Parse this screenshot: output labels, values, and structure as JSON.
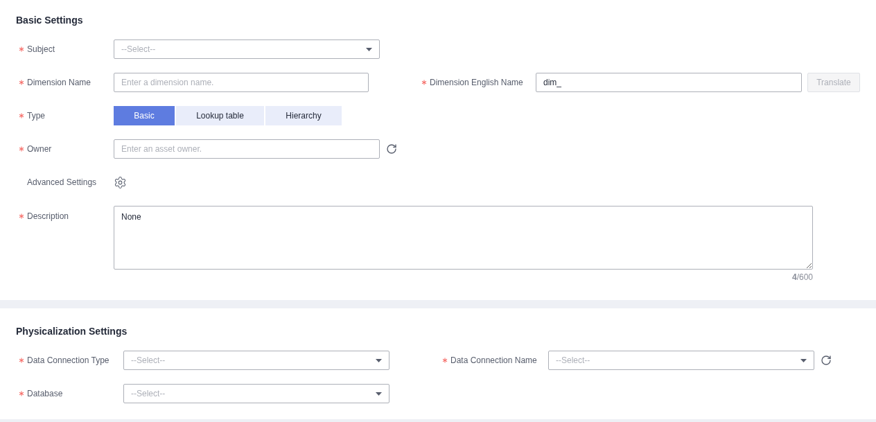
{
  "basic_settings": {
    "title": "Basic Settings",
    "fields": [
      {
        "kind": "select",
        "label": "Subject",
        "required": true,
        "placeholder": "--Select--"
      },
      {
        "kind": "input",
        "label": "Dimension Name",
        "required": true,
        "placeholder": "Enter a dimension name.",
        "side": {
          "kind": "input",
          "label": "Dimension English Name",
          "required": true,
          "value": "dim_",
          "button": {
            "label": "Translate",
            "disabled": true
          }
        }
      },
      {
        "kind": "segmented",
        "label": "Type",
        "required": true,
        "options": [
          {
            "label": "Basic",
            "selected": true
          },
          {
            "label": "Lookup table",
            "selected": false
          },
          {
            "label": "Hierarchy",
            "selected": false
          }
        ]
      },
      {
        "kind": "input",
        "label": "Owner",
        "required": true,
        "placeholder": "Enter an asset owner.",
        "refresh": true
      },
      {
        "kind": "gear",
        "label": "Advanced Settings",
        "required": false
      },
      {
        "kind": "textarea",
        "label": "Description",
        "required": true,
        "value": "None",
        "counter": "**4**/600"
      }
    ]
  },
  "physicalization_settings": {
    "title": "Physicalization Settings",
    "fields": [
      {
        "kind": "select",
        "label": "Data Connection Type",
        "required": true,
        "placeholder": "--Select--",
        "side": {
          "kind": "select",
          "label": "Data Connection Name",
          "required": true,
          "placeholder": "--Select--",
          "refresh": true
        }
      },
      {
        "kind": "select",
        "label": "Database",
        "required": true,
        "placeholder": "--Select--"
      }
    ]
  }
}
